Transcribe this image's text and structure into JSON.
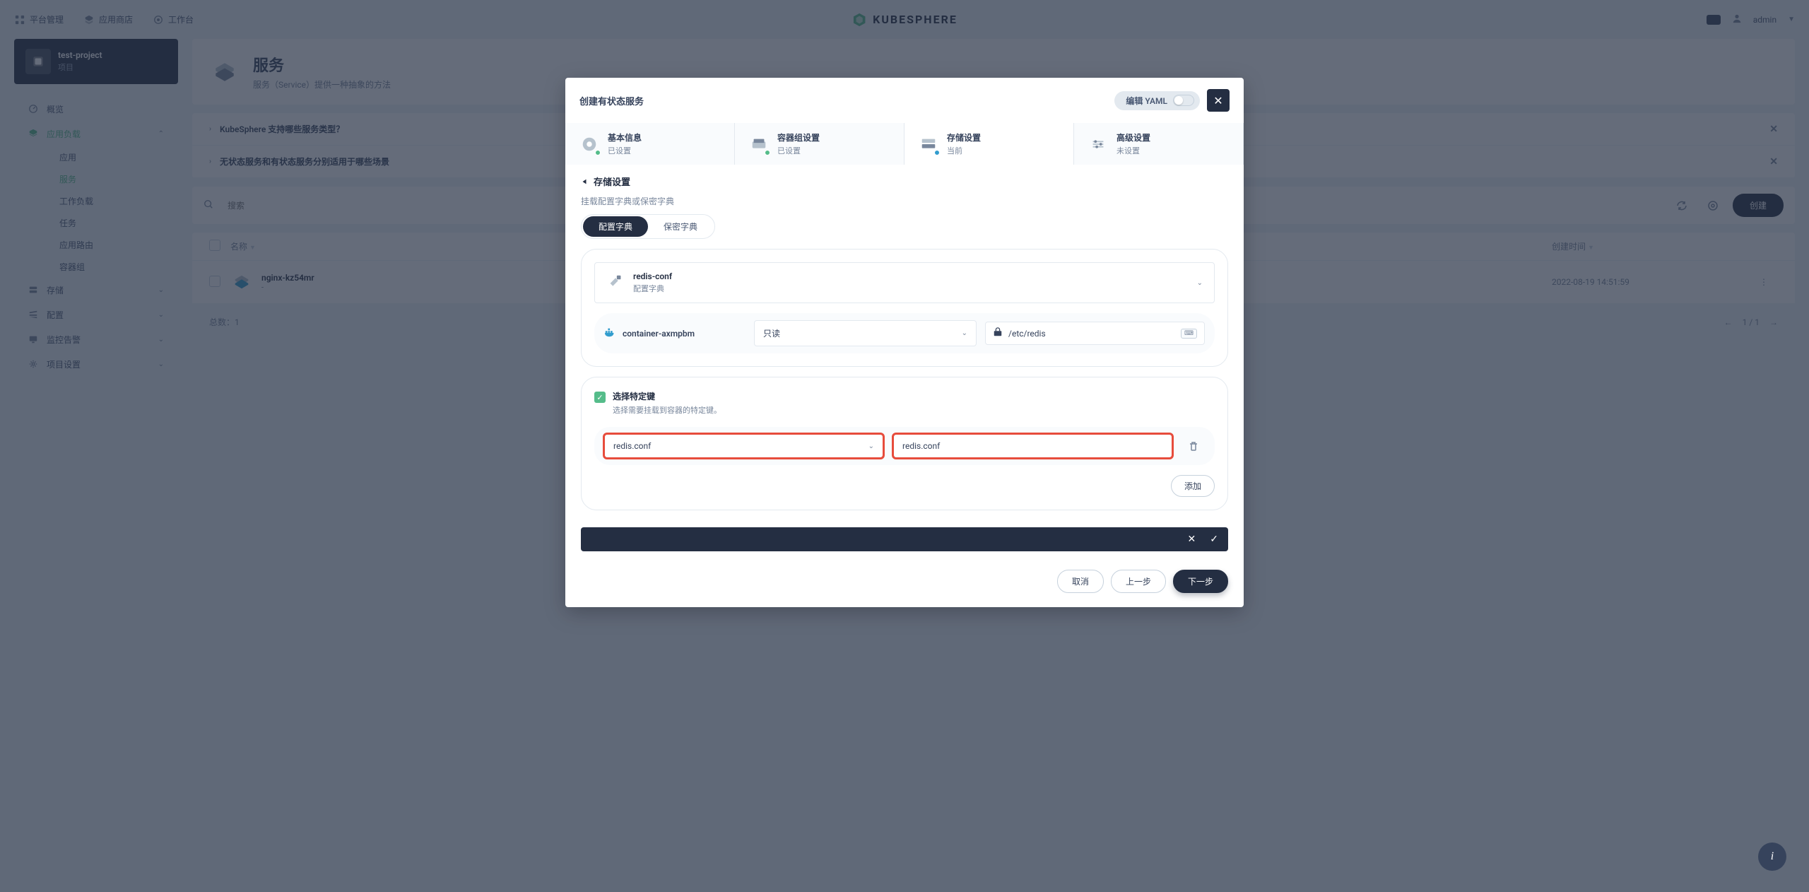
{
  "topbar": {
    "platform": "平台管理",
    "store": "应用商店",
    "workbench": "工作台",
    "user": "admin",
    "logo": "KUBESPHERE"
  },
  "project": {
    "name": "test-project",
    "type": "项目"
  },
  "nav": {
    "overview": "概览",
    "workloads": "应用负载",
    "sub": {
      "apps": "应用",
      "services": "服务",
      "workloads": "工作负载",
      "jobs": "任务",
      "routes": "应用路由",
      "pods": "容器组"
    },
    "storage": "存储",
    "config": "配置",
    "monitor": "监控告警",
    "settings": "项目设置"
  },
  "page": {
    "title": "服务",
    "desc": "服务（Service）提供一种抽象的方法"
  },
  "faq": {
    "q1": "KubeSphere 支持哪些服务类型？",
    "q2": "无状态服务和有状态服务分别适用于哪些场景"
  },
  "toolbar": {
    "search_placeholder": "搜索",
    "create": "创建"
  },
  "table": {
    "col_name": "名称",
    "col_time": "创建时间",
    "row_name": "nginx-kz54mr",
    "row_dash": "-",
    "row_time": "2022-08-19 14:51:59",
    "total": "总数：1",
    "pager": "1 / 1"
  },
  "modal": {
    "title": "创建有状态服务",
    "yaml": "编辑 YAML",
    "steps": {
      "s1": {
        "title": "基本信息",
        "sub": "已设置"
      },
      "s2": {
        "title": "容器组设置",
        "sub": "已设置"
      },
      "s3": {
        "title": "存储设置",
        "sub": "当前"
      },
      "s4": {
        "title": "高级设置",
        "sub": "未设置"
      }
    },
    "panel_title": "存储设置",
    "section_label": "挂载配置字典或保密字典",
    "pill_config": "配置字典",
    "pill_secret": "保密字典",
    "configmap": {
      "name": "redis-conf",
      "type": "配置字典"
    },
    "container": "container-axmpbm",
    "readonly": "只读",
    "mount_path": "/etc/redis",
    "keys": {
      "title": "选择特定键",
      "desc": "选择需要挂载到容器的特定键。",
      "key": "redis.conf",
      "file": "redis.conf",
      "add": "添加"
    },
    "footer": {
      "cancel": "取消",
      "prev": "上一步",
      "next": "下一步"
    }
  }
}
